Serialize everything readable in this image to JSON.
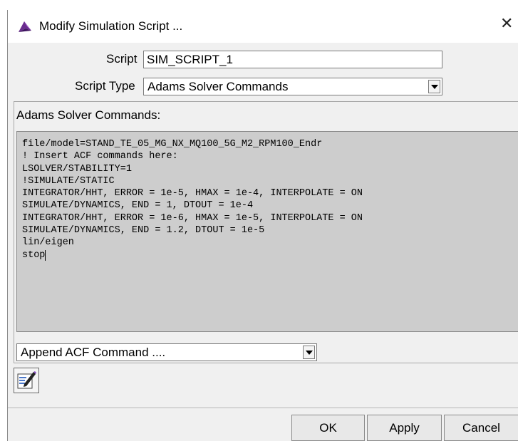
{
  "window": {
    "title": "Modify Simulation Script ..."
  },
  "form": {
    "script_label": "Script",
    "script_value": "SIM_SCRIPT_1",
    "script_type_label": "Script Type",
    "script_type_value": "Adams Solver Commands"
  },
  "commands": {
    "group_label": "Adams Solver Commands:",
    "text_before_caret": "file/model=STAND_TE_05_MG_NX_MQ100_5G_M2_RPM100_Endr\n! Insert ACF commands here:\nLSOLVER/STABILITY=1\n!SIMULATE/STATIC\nINTEGRATOR/HHT, ERROR = 1e-5, HMAX = 1e-4, INTERPOLATE = ON\nSIMULATE/DYNAMICS, END = 1, DTOUT = 1e-4\nINTEGRATOR/HHT, ERROR = 1e-6, HMAX = 1e-5, INTERPOLATE = ON\nSIMULATE/DYNAMICS, END = 1.2, DTOUT = 1e-5\nlin/eigen\nstop"
  },
  "append": {
    "value": "Append ACF Command ...."
  },
  "buttons": {
    "ok": "OK",
    "apply": "Apply",
    "cancel": "Cancel"
  },
  "icons": {
    "app": "adams-app-icon",
    "close": "close-icon",
    "editor": "text-editor-icon"
  },
  "colors": {
    "dialog_bg": "#f0f0f0",
    "text_area_bg": "#cdcdcd",
    "app_icon_accent": "#6b2d8f"
  }
}
